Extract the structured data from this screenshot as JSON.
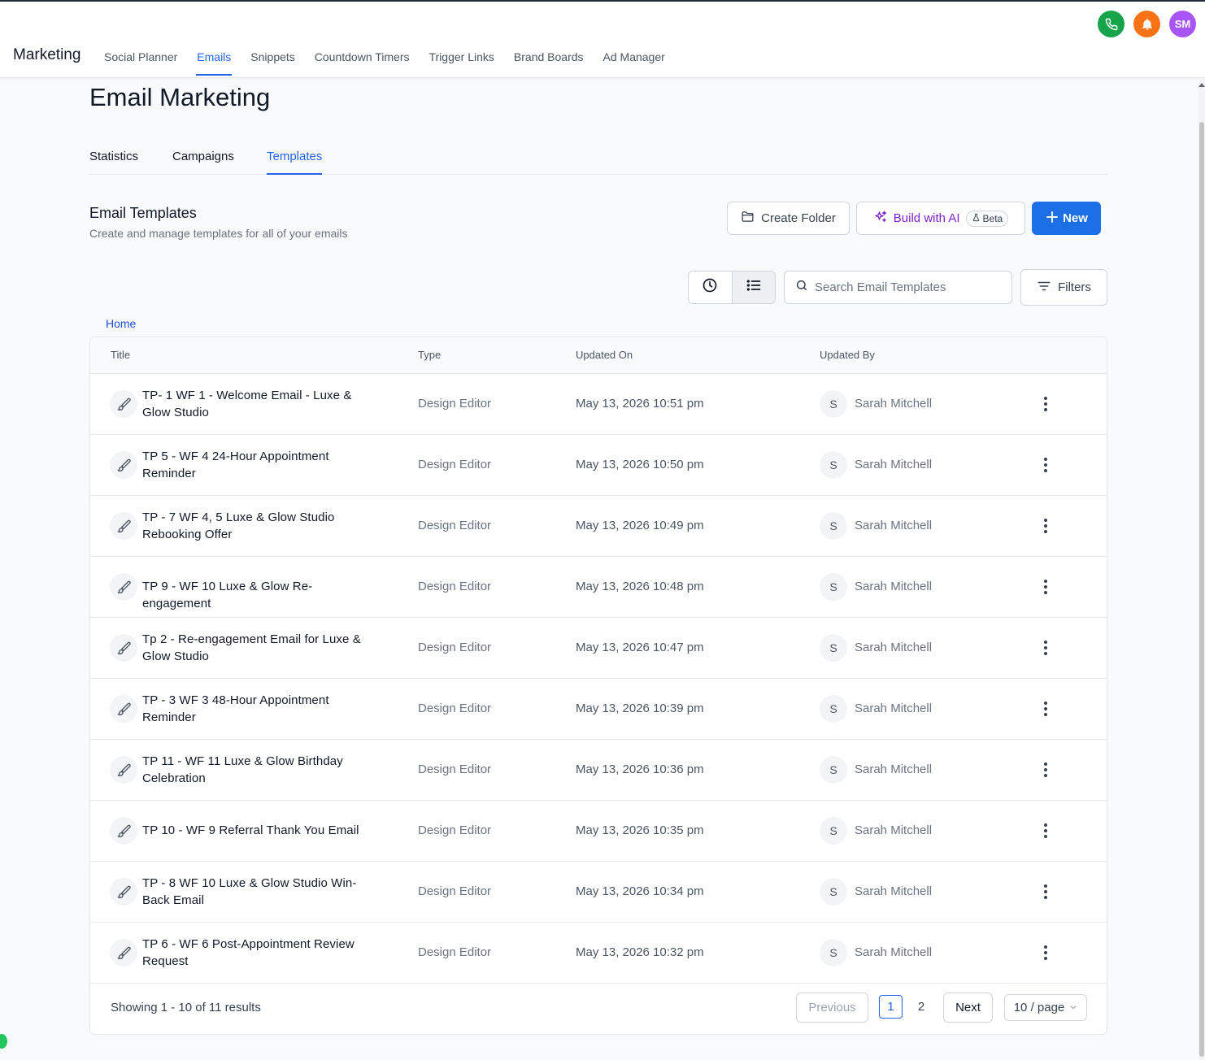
{
  "header": {
    "brand": "Marketing",
    "nav": [
      {
        "label": "Social Planner"
      },
      {
        "label": "Emails"
      },
      {
        "label": "Snippets"
      },
      {
        "label": "Countdown Timers"
      },
      {
        "label": "Trigger Links"
      },
      {
        "label": "Brand Boards"
      },
      {
        "label": "Ad Manager"
      }
    ],
    "active_nav": "Emails",
    "avatar_initials": "SM"
  },
  "page": {
    "title": "Email Marketing",
    "tabs": [
      {
        "label": "Statistics"
      },
      {
        "label": "Campaigns"
      },
      {
        "label": "Templates"
      }
    ],
    "active_tab": "Templates"
  },
  "section": {
    "title": "Email Templates",
    "subtitle": "Create and manage templates for all of your emails"
  },
  "actions": {
    "create_folder": "Create Folder",
    "build_ai": "Build with AI",
    "beta": "Beta",
    "new": "New",
    "filters": "Filters"
  },
  "search": {
    "placeholder": "Search Email Templates",
    "value": ""
  },
  "breadcrumb": "Home",
  "table": {
    "columns": [
      "Title",
      "Type",
      "Updated On",
      "Updated By"
    ],
    "rows": [
      {
        "title": "TP- 1 WF 1 - Welcome Email - Luxe & Glow Studio",
        "type": "Design Editor",
        "updated_on": "May 13, 2026 10:51 pm",
        "avatar": "S",
        "updated_by": "Sarah Mitchell"
      },
      {
        "title": "TP 5 - WF 4 24-Hour Appointment Reminder",
        "type": "Design Editor",
        "updated_on": "May 13, 2026 10:50 pm",
        "avatar": "S",
        "updated_by": "Sarah Mitchell"
      },
      {
        "title": "TP - 7 WF 4, 5 Luxe & Glow Studio Rebooking Offer",
        "type": "Design Editor",
        "updated_on": "May 13, 2026 10:49 pm",
        "avatar": "S",
        "updated_by": "Sarah Mitchell"
      },
      {
        "title": "TP 9 - WF 10 Luxe & Glow Re-engagement",
        "type": "Design Editor",
        "updated_on": "May 13, 2026 10:48 pm",
        "avatar": "S",
        "updated_by": "Sarah Mitchell"
      },
      {
        "title": "Tp 2 - Re-engagement Email for Luxe & Glow Studio",
        "type": "Design Editor",
        "updated_on": "May 13, 2026 10:47 pm",
        "avatar": "S",
        "updated_by": "Sarah Mitchell"
      },
      {
        "title": "TP - 3 WF 3 48-Hour Appointment Reminder",
        "type": "Design Editor",
        "updated_on": "May 13, 2026 10:39 pm",
        "avatar": "S",
        "updated_by": "Sarah Mitchell"
      },
      {
        "title": "TP 11 - WF 11 Luxe & Glow Birthday Celebration",
        "type": "Design Editor",
        "updated_on": "May 13, 2026 10:36 pm",
        "avatar": "S",
        "updated_by": "Sarah Mitchell"
      },
      {
        "title": "TP 10 - WF 9 Referral Thank You Email",
        "type": "Design Editor",
        "updated_on": "May 13, 2026 10:35 pm",
        "avatar": "S",
        "updated_by": "Sarah Mitchell"
      },
      {
        "title": "TP - 8 WF 10 Luxe & Glow Studio Win-Back Email",
        "type": "Design Editor",
        "updated_on": "May 13, 2026 10:34 pm",
        "avatar": "S",
        "updated_by": "Sarah Mitchell"
      },
      {
        "title": "TP 6 - WF 6 Post-Appointment Review Request",
        "type": "Design Editor",
        "updated_on": "May 13, 2026 10:32 pm",
        "avatar": "S",
        "updated_by": "Sarah Mitchell"
      }
    ]
  },
  "pagination": {
    "summary": "Showing 1 - 10 of 11 results",
    "previous": "Previous",
    "pages": [
      "1",
      "2"
    ],
    "current_page": "1",
    "next": "Next",
    "page_size": "10 / page"
  },
  "colors": {
    "accent": "#2563eb",
    "primary_button": "#1d6fe5",
    "ai_purple": "#7e22ce",
    "phone_green": "#16a34a",
    "bell_orange": "#f97316",
    "avatar_purple": "#a855f7"
  },
  "icons": {
    "phone": "phone-icon",
    "bell": "bell-icon",
    "folder": "folder-icon",
    "sparkle": "sparkle-icon",
    "flask": "flask-icon",
    "plus": "plus-icon",
    "clock": "clock-icon",
    "list": "list-icon",
    "search": "search-icon",
    "filter": "filter-icon",
    "brush": "brush-icon",
    "more": "more-vertical-icon",
    "chevron": "chevron-down-icon"
  }
}
